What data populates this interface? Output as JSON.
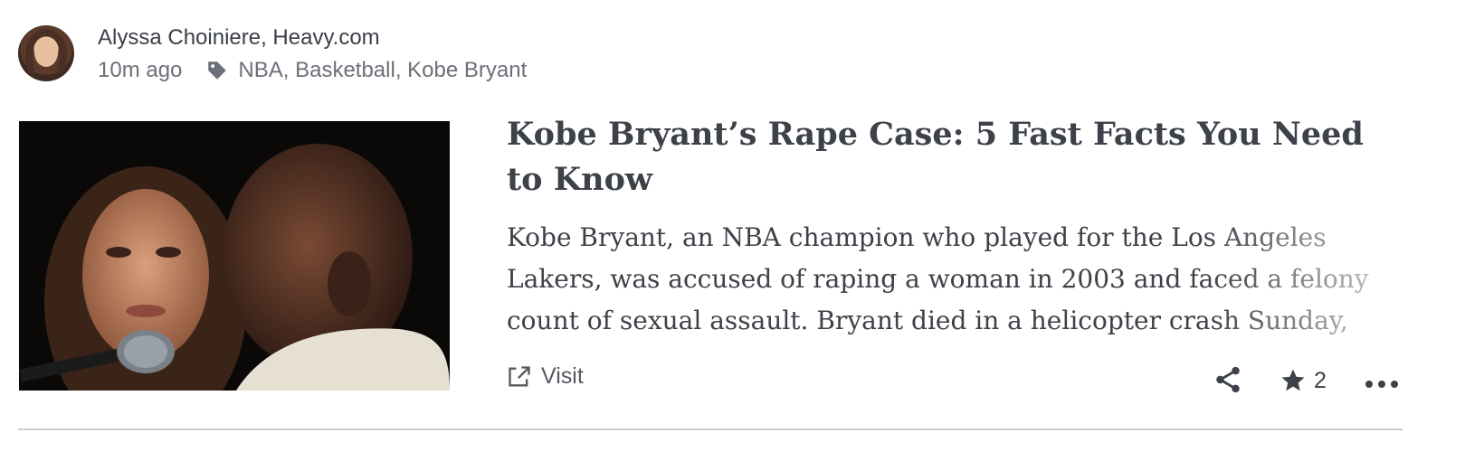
{
  "post": {
    "author": "Alyssa Choiniere, Heavy.com",
    "time_ago": "10m ago",
    "tags": "NBA, Basketball, Kobe Bryant",
    "title": "Kobe Bryant’s Rape Case: 5 Fast Facts You Need to Know",
    "excerpt": "Kobe Bryant, an NBA champion who played for the Los Angeles Lakers, was accused of raping a woman in 2003 and faced a felony count of sexual assault. Bryant died in a helicopter crash Sunday,",
    "visit_label": "Visit",
    "star_count": "2"
  },
  "icons": {
    "tag": "tag-icon",
    "external_link": "external-link-icon",
    "share": "share-icon",
    "star": "star-icon",
    "more": "more-horizontal-icon"
  },
  "colors": {
    "text": "#3d4148",
    "muted": "#6b7078",
    "divider": "#c9ccd1"
  }
}
